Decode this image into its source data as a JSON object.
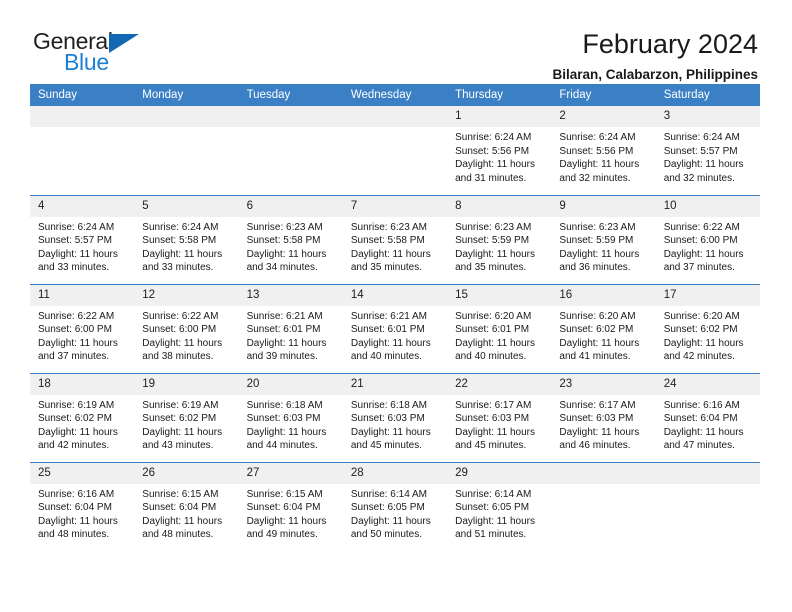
{
  "brand": {
    "name_top": "General",
    "name_bottom": "Blue",
    "triangle_color": "#1268b3",
    "blue_text_color": "#1c7fd4"
  },
  "header": {
    "title": "February 2024",
    "subtitle": "Bilaran, Calabarzon, Philippines"
  },
  "theme": {
    "header_blue": "#3b7fc4",
    "daynum_band": "#f0f0f0",
    "text": "#1a1a1a"
  },
  "weekday_headers": [
    "Sunday",
    "Monday",
    "Tuesday",
    "Wednesday",
    "Thursday",
    "Friday",
    "Saturday"
  ],
  "weeks": [
    [
      {
        "day": "",
        "sunrise": "",
        "sunset": "",
        "daylight": "",
        "empty": true
      },
      {
        "day": "",
        "sunrise": "",
        "sunset": "",
        "daylight": "",
        "empty": true
      },
      {
        "day": "",
        "sunrise": "",
        "sunset": "",
        "daylight": "",
        "empty": true
      },
      {
        "day": "",
        "sunrise": "",
        "sunset": "",
        "daylight": "",
        "empty": true
      },
      {
        "day": "1",
        "sunrise": "Sunrise: 6:24 AM",
        "sunset": "Sunset: 5:56 PM",
        "daylight": "Daylight: 11 hours and 31 minutes."
      },
      {
        "day": "2",
        "sunrise": "Sunrise: 6:24 AM",
        "sunset": "Sunset: 5:56 PM",
        "daylight": "Daylight: 11 hours and 32 minutes."
      },
      {
        "day": "3",
        "sunrise": "Sunrise: 6:24 AM",
        "sunset": "Sunset: 5:57 PM",
        "daylight": "Daylight: 11 hours and 32 minutes."
      }
    ],
    [
      {
        "day": "4",
        "sunrise": "Sunrise: 6:24 AM",
        "sunset": "Sunset: 5:57 PM",
        "daylight": "Daylight: 11 hours and 33 minutes."
      },
      {
        "day": "5",
        "sunrise": "Sunrise: 6:24 AM",
        "sunset": "Sunset: 5:58 PM",
        "daylight": "Daylight: 11 hours and 33 minutes."
      },
      {
        "day": "6",
        "sunrise": "Sunrise: 6:23 AM",
        "sunset": "Sunset: 5:58 PM",
        "daylight": "Daylight: 11 hours and 34 minutes."
      },
      {
        "day": "7",
        "sunrise": "Sunrise: 6:23 AM",
        "sunset": "Sunset: 5:58 PM",
        "daylight": "Daylight: 11 hours and 35 minutes."
      },
      {
        "day": "8",
        "sunrise": "Sunrise: 6:23 AM",
        "sunset": "Sunset: 5:59 PM",
        "daylight": "Daylight: 11 hours and 35 minutes."
      },
      {
        "day": "9",
        "sunrise": "Sunrise: 6:23 AM",
        "sunset": "Sunset: 5:59 PM",
        "daylight": "Daylight: 11 hours and 36 minutes."
      },
      {
        "day": "10",
        "sunrise": "Sunrise: 6:22 AM",
        "sunset": "Sunset: 6:00 PM",
        "daylight": "Daylight: 11 hours and 37 minutes."
      }
    ],
    [
      {
        "day": "11",
        "sunrise": "Sunrise: 6:22 AM",
        "sunset": "Sunset: 6:00 PM",
        "daylight": "Daylight: 11 hours and 37 minutes."
      },
      {
        "day": "12",
        "sunrise": "Sunrise: 6:22 AM",
        "sunset": "Sunset: 6:00 PM",
        "daylight": "Daylight: 11 hours and 38 minutes."
      },
      {
        "day": "13",
        "sunrise": "Sunrise: 6:21 AM",
        "sunset": "Sunset: 6:01 PM",
        "daylight": "Daylight: 11 hours and 39 minutes."
      },
      {
        "day": "14",
        "sunrise": "Sunrise: 6:21 AM",
        "sunset": "Sunset: 6:01 PM",
        "daylight": "Daylight: 11 hours and 40 minutes."
      },
      {
        "day": "15",
        "sunrise": "Sunrise: 6:20 AM",
        "sunset": "Sunset: 6:01 PM",
        "daylight": "Daylight: 11 hours and 40 minutes."
      },
      {
        "day": "16",
        "sunrise": "Sunrise: 6:20 AM",
        "sunset": "Sunset: 6:02 PM",
        "daylight": "Daylight: 11 hours and 41 minutes."
      },
      {
        "day": "17",
        "sunrise": "Sunrise: 6:20 AM",
        "sunset": "Sunset: 6:02 PM",
        "daylight": "Daylight: 11 hours and 42 minutes."
      }
    ],
    [
      {
        "day": "18",
        "sunrise": "Sunrise: 6:19 AM",
        "sunset": "Sunset: 6:02 PM",
        "daylight": "Daylight: 11 hours and 42 minutes."
      },
      {
        "day": "19",
        "sunrise": "Sunrise: 6:19 AM",
        "sunset": "Sunset: 6:02 PM",
        "daylight": "Daylight: 11 hours and 43 minutes."
      },
      {
        "day": "20",
        "sunrise": "Sunrise: 6:18 AM",
        "sunset": "Sunset: 6:03 PM",
        "daylight": "Daylight: 11 hours and 44 minutes."
      },
      {
        "day": "21",
        "sunrise": "Sunrise: 6:18 AM",
        "sunset": "Sunset: 6:03 PM",
        "daylight": "Daylight: 11 hours and 45 minutes."
      },
      {
        "day": "22",
        "sunrise": "Sunrise: 6:17 AM",
        "sunset": "Sunset: 6:03 PM",
        "daylight": "Daylight: 11 hours and 45 minutes."
      },
      {
        "day": "23",
        "sunrise": "Sunrise: 6:17 AM",
        "sunset": "Sunset: 6:03 PM",
        "daylight": "Daylight: 11 hours and 46 minutes."
      },
      {
        "day": "24",
        "sunrise": "Sunrise: 6:16 AM",
        "sunset": "Sunset: 6:04 PM",
        "daylight": "Daylight: 11 hours and 47 minutes."
      }
    ],
    [
      {
        "day": "25",
        "sunrise": "Sunrise: 6:16 AM",
        "sunset": "Sunset: 6:04 PM",
        "daylight": "Daylight: 11 hours and 48 minutes."
      },
      {
        "day": "26",
        "sunrise": "Sunrise: 6:15 AM",
        "sunset": "Sunset: 6:04 PM",
        "daylight": "Daylight: 11 hours and 48 minutes."
      },
      {
        "day": "27",
        "sunrise": "Sunrise: 6:15 AM",
        "sunset": "Sunset: 6:04 PM",
        "daylight": "Daylight: 11 hours and 49 minutes."
      },
      {
        "day": "28",
        "sunrise": "Sunrise: 6:14 AM",
        "sunset": "Sunset: 6:05 PM",
        "daylight": "Daylight: 11 hours and 50 minutes."
      },
      {
        "day": "29",
        "sunrise": "Sunrise: 6:14 AM",
        "sunset": "Sunset: 6:05 PM",
        "daylight": "Daylight: 11 hours and 51 minutes."
      },
      {
        "day": "",
        "sunrise": "",
        "sunset": "",
        "daylight": "",
        "empty": true
      },
      {
        "day": "",
        "sunrise": "",
        "sunset": "",
        "daylight": "",
        "empty": true
      }
    ]
  ]
}
